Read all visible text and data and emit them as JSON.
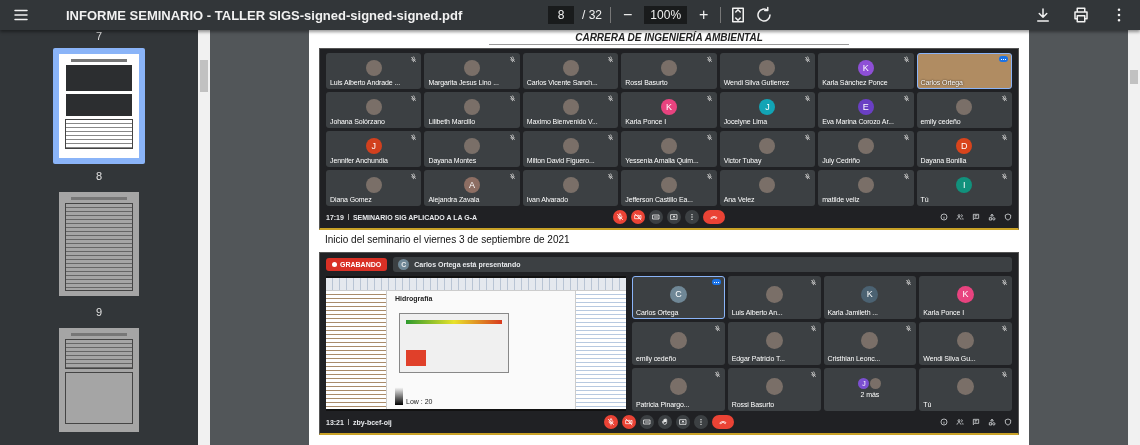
{
  "toolbar": {
    "title": "INFORME SEMINARIO - TALLER SIGS-signed-signed-signed.pdf",
    "page_input": "8",
    "page_total": "/ 32",
    "zoom_out": "−",
    "zoom": "100%",
    "zoom_in": "+"
  },
  "sidebar": {
    "previous_label": "7",
    "thumbnails": [
      {
        "label": "8",
        "selected": true,
        "kind": "meeting"
      },
      {
        "label": "9",
        "selected": false,
        "kind": "table"
      },
      {
        "selected": false,
        "kind": "form"
      }
    ]
  },
  "page": {
    "header": "CARRERA DE INGENIERÍA AMBIENTAL",
    "meeting_1": {
      "tiles": [
        {
          "name": "Luis Alberto Andrade ...",
          "kind": "photo",
          "muted": true,
          "active": false
        },
        {
          "name": "Margarita Jesus Lino ...",
          "kind": "photo",
          "muted": true,
          "active": false
        },
        {
          "name": "Carlos Vicente Sanch...",
          "kind": "photo",
          "muted": true,
          "active": false
        },
        {
          "name": "Rossi Basurto",
          "kind": "photo",
          "muted": true,
          "active": false
        },
        {
          "name": "Wendi Silva Gutierrez",
          "kind": "photo",
          "muted": true,
          "active": false
        },
        {
          "name": "Karla Sánchez Ponce",
          "kind": "letter",
          "letter": "K",
          "color": "#8e4fd6",
          "muted": true,
          "active": false
        },
        {
          "name": "Carlos Ortega",
          "kind": "video",
          "muted": false,
          "active": true
        },
        {
          "name": "Johana Solórzano",
          "kind": "photo",
          "muted": true,
          "active": false
        },
        {
          "name": "Lilibeth Marcillo",
          "kind": "photo",
          "muted": true,
          "active": false
        },
        {
          "name": "Maximo Bienvenido V...",
          "kind": "photo",
          "muted": true,
          "active": false
        },
        {
          "name": "Karla Ponce I",
          "kind": "letter",
          "letter": "K",
          "color": "#e8437f",
          "muted": true,
          "active": false
        },
        {
          "name": "Jocelyne Lima",
          "kind": "letter",
          "letter": "J",
          "color": "#12a4b5",
          "muted": true,
          "active": false
        },
        {
          "name": "Eva Marina Corozo Ar...",
          "kind": "letter",
          "letter": "E",
          "color": "#6a3fc4",
          "muted": true,
          "active": false
        },
        {
          "name": "emily cedeño",
          "kind": "photo",
          "muted": true,
          "active": false
        },
        {
          "name": "Jennifer Anchundia",
          "kind": "letter",
          "letter": "J",
          "color": "#d2401e",
          "muted": true,
          "active": false
        },
        {
          "name": "Dayana Montes",
          "kind": "photo",
          "muted": true,
          "active": false
        },
        {
          "name": "Milton David Figuero...",
          "kind": "photo",
          "muted": true,
          "active": false
        },
        {
          "name": "Yessenia Amalia Quim...",
          "kind": "photo",
          "muted": true,
          "active": false
        },
        {
          "name": "Victor Tubay",
          "kind": "photo",
          "muted": true,
          "active": false
        },
        {
          "name": "July Cedriño",
          "kind": "photo",
          "muted": true,
          "active": false
        },
        {
          "name": "Dayana Bonilla",
          "kind": "letter",
          "letter": "D",
          "color": "#d9441c",
          "muted": true,
          "active": false
        },
        {
          "name": "Diana Gomez",
          "kind": "photo",
          "muted": true,
          "active": false
        },
        {
          "name": "Alejandra Zavala",
          "kind": "letter",
          "letter": "A",
          "color": "#8d6e63",
          "muted": true,
          "active": false
        },
        {
          "name": "Ivan Alvarado",
          "kind": "photo",
          "muted": true,
          "active": false
        },
        {
          "name": "Jefferson Castillo Ea...",
          "kind": "photo",
          "muted": true,
          "active": false
        },
        {
          "name": "Ana Velez",
          "kind": "photo",
          "muted": true,
          "active": false
        },
        {
          "name": "matilde veliz",
          "kind": "photo",
          "muted": true,
          "active": false
        },
        {
          "name": "Tú",
          "kind": "letter",
          "letter": "I",
          "color": "#11917c",
          "muted": true,
          "active": false
        }
      ],
      "time": "17:19",
      "title": "SEMINARIO SIG APLICADO A LA G-A",
      "controls": [
        {
          "kind": "mic",
          "off": true
        },
        {
          "kind": "camera",
          "off": true
        },
        {
          "kind": "captions",
          "off": false
        },
        {
          "kind": "present",
          "off": false
        },
        {
          "kind": "more",
          "off": false
        },
        {
          "kind": "hangup",
          "off": false
        }
      ],
      "side_controls": [
        {
          "kind": "info"
        },
        {
          "kind": "people"
        },
        {
          "kind": "chat"
        },
        {
          "kind": "activities"
        },
        {
          "kind": "shield"
        }
      ]
    },
    "caption": "Inicio del seminario el viernes 3 de septiembre de 2021",
    "meeting_2": {
      "recording": "GRABANDO",
      "presenter_initial": "C",
      "presenter_text": "Carlos Ortega está presentando",
      "shared_screen": {
        "heading": "Hidrografía",
        "legend": "Low : 20"
      },
      "tiles": [
        {
          "name": "Carlos Ortega",
          "kind": "letter",
          "letter": "C",
          "color": "#6f8796",
          "muted": false,
          "active": true
        },
        {
          "name": "Luis Alberto An...",
          "kind": "photo",
          "muted": true,
          "active": false
        },
        {
          "name": "Karla Jamileth ...",
          "kind": "letter",
          "letter": "K",
          "color": "#4b6272",
          "muted": true,
          "active": false
        },
        {
          "name": "Karla Ponce I",
          "kind": "letter",
          "letter": "K",
          "color": "#e8437f",
          "muted": true,
          "active": false
        },
        {
          "name": "emily cedeño",
          "kind": "photo",
          "muted": true,
          "active": false
        },
        {
          "name": "Edgar Patricio T...",
          "kind": "photo",
          "muted": true,
          "active": false
        },
        {
          "name": "Cristhian Leonc...",
          "kind": "photo",
          "muted": true,
          "active": false
        },
        {
          "name": "Wendi Silva Gu...",
          "kind": "photo",
          "muted": true,
          "active": false
        },
        {
          "name": "Patricia Pinargo...",
          "kind": "photo",
          "muted": true,
          "active": false
        },
        {
          "name": "Rossi Basurto",
          "kind": "photo",
          "muted": true,
          "active": false
        },
        {
          "name": "2 más",
          "kind": "stack",
          "letter": "J",
          "color": "#7b4fd0",
          "muted": false,
          "active": false
        },
        {
          "name": "Tú",
          "kind": "photo",
          "muted": true,
          "active": false
        }
      ],
      "time": "13:21",
      "title": "zby-bcef-oij",
      "controls": [
        {
          "kind": "mic",
          "off": true
        },
        {
          "kind": "camera",
          "off": true
        },
        {
          "kind": "captions",
          "off": false
        },
        {
          "kind": "hand",
          "off": false
        },
        {
          "kind": "present",
          "off": false
        },
        {
          "kind": "more",
          "off": false
        },
        {
          "kind": "hangup",
          "off": false
        }
      ],
      "side_controls": [
        {
          "kind": "info"
        },
        {
          "kind": "people"
        },
        {
          "kind": "chat"
        },
        {
          "kind": "activities"
        },
        {
          "kind": "shield"
        }
      ]
    }
  }
}
